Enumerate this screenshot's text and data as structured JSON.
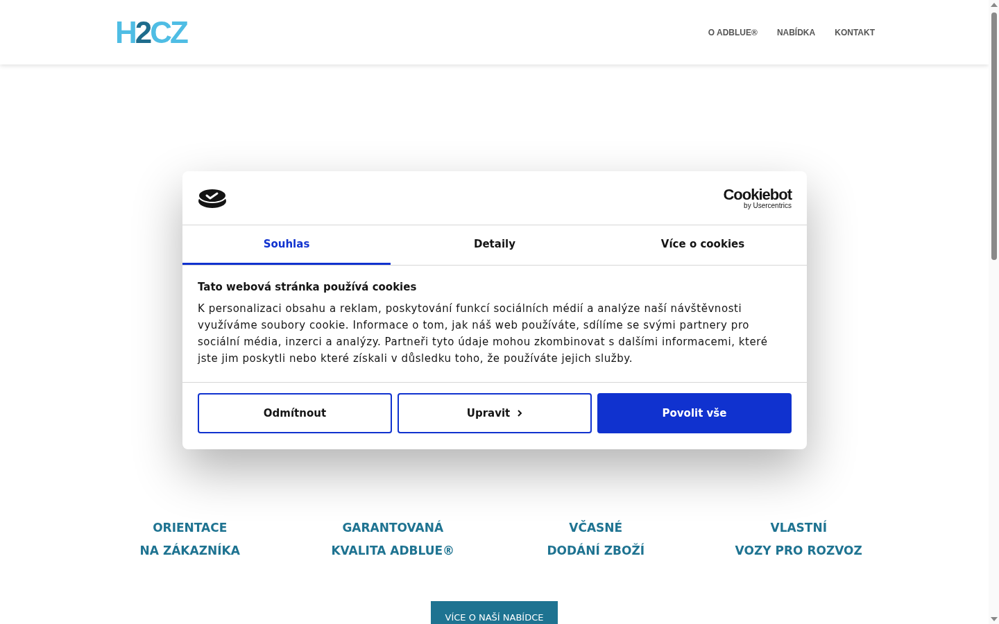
{
  "header": {
    "logo": {
      "letters": [
        "H",
        "2",
        "CZ"
      ]
    },
    "nav": [
      "O ADBLUE®",
      "NABÍDKA",
      "KONTAKT"
    ]
  },
  "page": {
    "features": [
      {
        "line_1": "ORIENTACE",
        "line_2": "NA ZÁKAZNÍKA"
      },
      {
        "line_1": "GARANTOVANÁ",
        "line_2": "KVALITA ADBLUE®"
      },
      {
        "line_1": "VČASNÉ",
        "line_2": "DODÁNÍ ZBOŽÍ"
      },
      {
        "line_1": "VLASTNÍ",
        "line_2": "VOZY PRO ROZVOZ"
      }
    ],
    "button": "VÍCE O NAŠÍ NABÍDCE"
  },
  "cookie_dialog": {
    "brand": {
      "name": "Cookiebot",
      "byline": "by Usercentrics"
    },
    "tabs": [
      {
        "label": "Souhlas",
        "selected": true
      },
      {
        "label": "Detaily",
        "selected": false
      },
      {
        "label": "Více o cookies",
        "selected": false
      }
    ],
    "heading": "Tato webová stránka používá cookies",
    "text": "K personalizaci obsahu a reklam, poskytování funkcí sociálních médií a analýze naší návštěvnosti využíváme soubory cookie. Informace o tom, jak náš web používáte, sdílíme se svými partnery pro sociální média, inzerci a analýzy. Partneři tyto údaje mohou zkombinovat s dalšími informacemi, které jste jim poskytli nebo které získali v důsledku toho, že používáte jejich služby.",
    "buttons": [
      {
        "label": "Odmítnout",
        "kind": "outline"
      },
      {
        "label": "Upravit",
        "kind": "more"
      },
      {
        "label": "Povolit vše",
        "kind": "primary"
      }
    ]
  }
}
